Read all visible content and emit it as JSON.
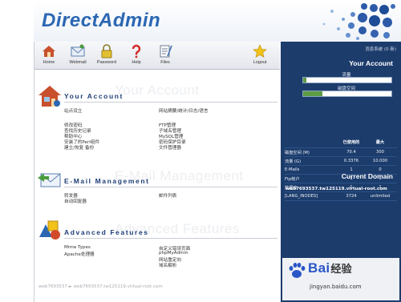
{
  "app": {
    "logo": "DirectAdmin"
  },
  "toolbar": {
    "items": [
      {
        "label": "Home",
        "icon": "home-icon"
      },
      {
        "label": "Webmail",
        "icon": "envelope-icon"
      },
      {
        "label": "Password",
        "icon": "lock-icon"
      },
      {
        "label": "Help",
        "icon": "question-icon"
      },
      {
        "label": "Files",
        "icon": "files-icon"
      },
      {
        "label": "Logout",
        "icon": "star-icon"
      }
    ]
  },
  "sections": {
    "account": {
      "title": "Your Account",
      "ghost": "Your Account",
      "links_left": [
        "站点设立",
        "修改密码",
        "查找历史记录",
        "帮助中心",
        "安装了的Perl组件",
        "建立/恢复 备份"
      ],
      "links_right": [
        "网站摘要/统计/日志/语言",
        "FTP管理",
        "子域名管理",
        "MySQL管理",
        "密码保护目录",
        "文件管理器"
      ]
    },
    "email": {
      "title": "E-Mail Management",
      "ghost": "E-Mail Management",
      "links_left": [
        "转发器",
        "自动回复器"
      ],
      "links_right": [
        "邮件列表"
      ]
    },
    "advanced": {
      "title": "Advanced Features",
      "ghost": "Advanced Features",
      "links_left": [
        "Mime Types",
        "Apache处理器"
      ],
      "links_right": [
        "自定义错误页面",
        "phpMyAdmin",
        "网站重定向",
        "域名解析"
      ]
    }
  },
  "footer": {
    "text": "web7693537 ► web7693537.tw125119.virtual-root.com"
  },
  "sidebar": {
    "top_link": "消息系统 (0 新)",
    "your_account": "Your Account",
    "bar1_label": "流量",
    "bar2_label": "磁盘空间",
    "bar1_fraction": 0.04,
    "bar2_fraction": 0.22,
    "stats_header": [
      "",
      "已使用的",
      "最大"
    ],
    "stats": [
      [
        "磁盘空间 (M)",
        "70.4",
        "300"
      ],
      [
        "流量 (G)",
        "0.3376",
        "10.000"
      ],
      [
        "E-Mails",
        "1",
        "0"
      ],
      [
        "Ftp帐户",
        "1",
        "1"
      ],
      [
        "数据库",
        "1",
        "1"
      ],
      [
        "[LANG_INODES]",
        "3724",
        "unlimited"
      ]
    ],
    "current_domain_title": "Current Domain",
    "current_domain": "web7693537.tw125119.virtual-root.com"
  },
  "watermark": {
    "brand": "Bai经验",
    "brand_main": "Bai",
    "brand_suffix": "经验",
    "url": "jingyan.baidu.com"
  },
  "colors": {
    "brand_blue": "#2b67b3",
    "sidebar_bg": "#1c3c6c",
    "section_title": "#1e3f78",
    "bar_fill": "#5e9b45"
  }
}
